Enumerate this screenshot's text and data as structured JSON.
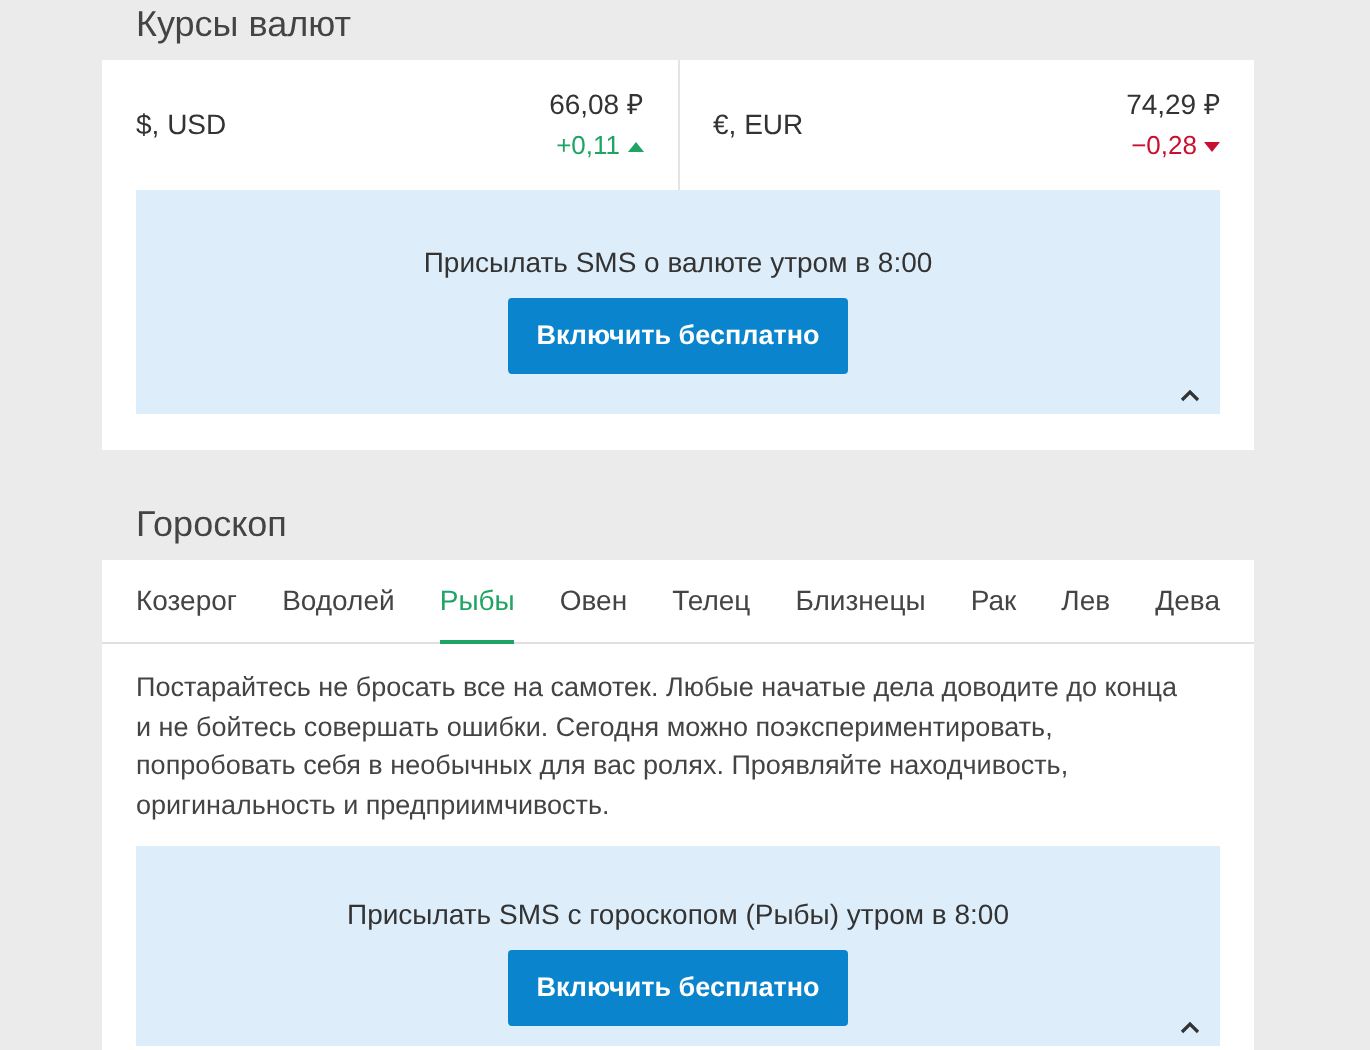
{
  "currency_section": {
    "title": "Курсы валют",
    "rates": [
      {
        "name": "$, USD",
        "value": "66,08 ₽",
        "change": "+0,11",
        "rising": true
      },
      {
        "name": "€, EUR",
        "value": "74,29 ₽",
        "change": "−0,28",
        "rising": false
      }
    ],
    "sms_promo": {
      "text": "Присылать SMS о валюте утром в 8:00",
      "button": "Включить бесплатно",
      "expanded": true
    }
  },
  "horoscope_section": {
    "title": "Гороскоп",
    "tabs": [
      {
        "label": "Козерог",
        "selected": false
      },
      {
        "label": "Водолей",
        "selected": false
      },
      {
        "label": "Рыбы",
        "selected": true
      },
      {
        "label": "Овен",
        "selected": false
      },
      {
        "label": "Телец",
        "selected": false
      },
      {
        "label": "Близнецы",
        "selected": false
      },
      {
        "label": "Рак",
        "selected": false
      },
      {
        "label": "Лев",
        "selected": false
      },
      {
        "label": "Дева",
        "selected": false
      }
    ],
    "forecast": "Постарайтесь не бросать все на самотек. Любые начатые дела доводите до конца и не бойтесь совершать ошибки. Сегодня можно поэкспериментировать, попробовать себя в необычных для вас ролях. Проявляйте находчивость, оригинальность и предприимчивость.",
    "sms_promo": {
      "text": "Присылать SMS с гороскопом (Рыбы) утром в 8:00",
      "button": "Включить бесплатно",
      "expanded": true
    }
  }
}
